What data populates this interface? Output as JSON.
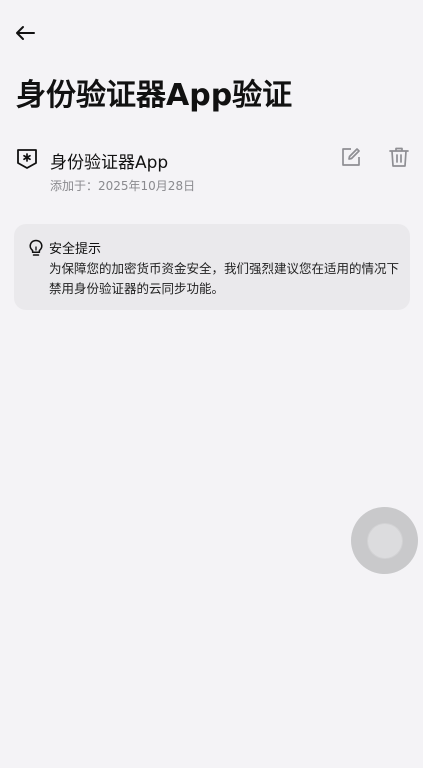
{
  "page": {
    "title": "身份验证器App验证"
  },
  "authenticator": {
    "name": "身份验证器App",
    "added_date": "添加于：2025年10月28日"
  },
  "security_tip": {
    "title": "安全提示",
    "body": "为保障您的加密货币资金安全，我们强烈建议您在适用的情况下禁用身份验证器的云同步功能。"
  },
  "icons": {
    "back": "back-arrow-icon",
    "authenticator": "shield-asterisk-icon",
    "edit": "edit-icon",
    "delete": "trash-icon",
    "tip": "lightbulb-icon",
    "floating": "assistive-touch-icon"
  },
  "colors": {
    "background": "#f4f3f6",
    "card_background": "#eae9ec",
    "secondary_text": "#8a8a8e",
    "icon_gray": "#8e8e93"
  }
}
